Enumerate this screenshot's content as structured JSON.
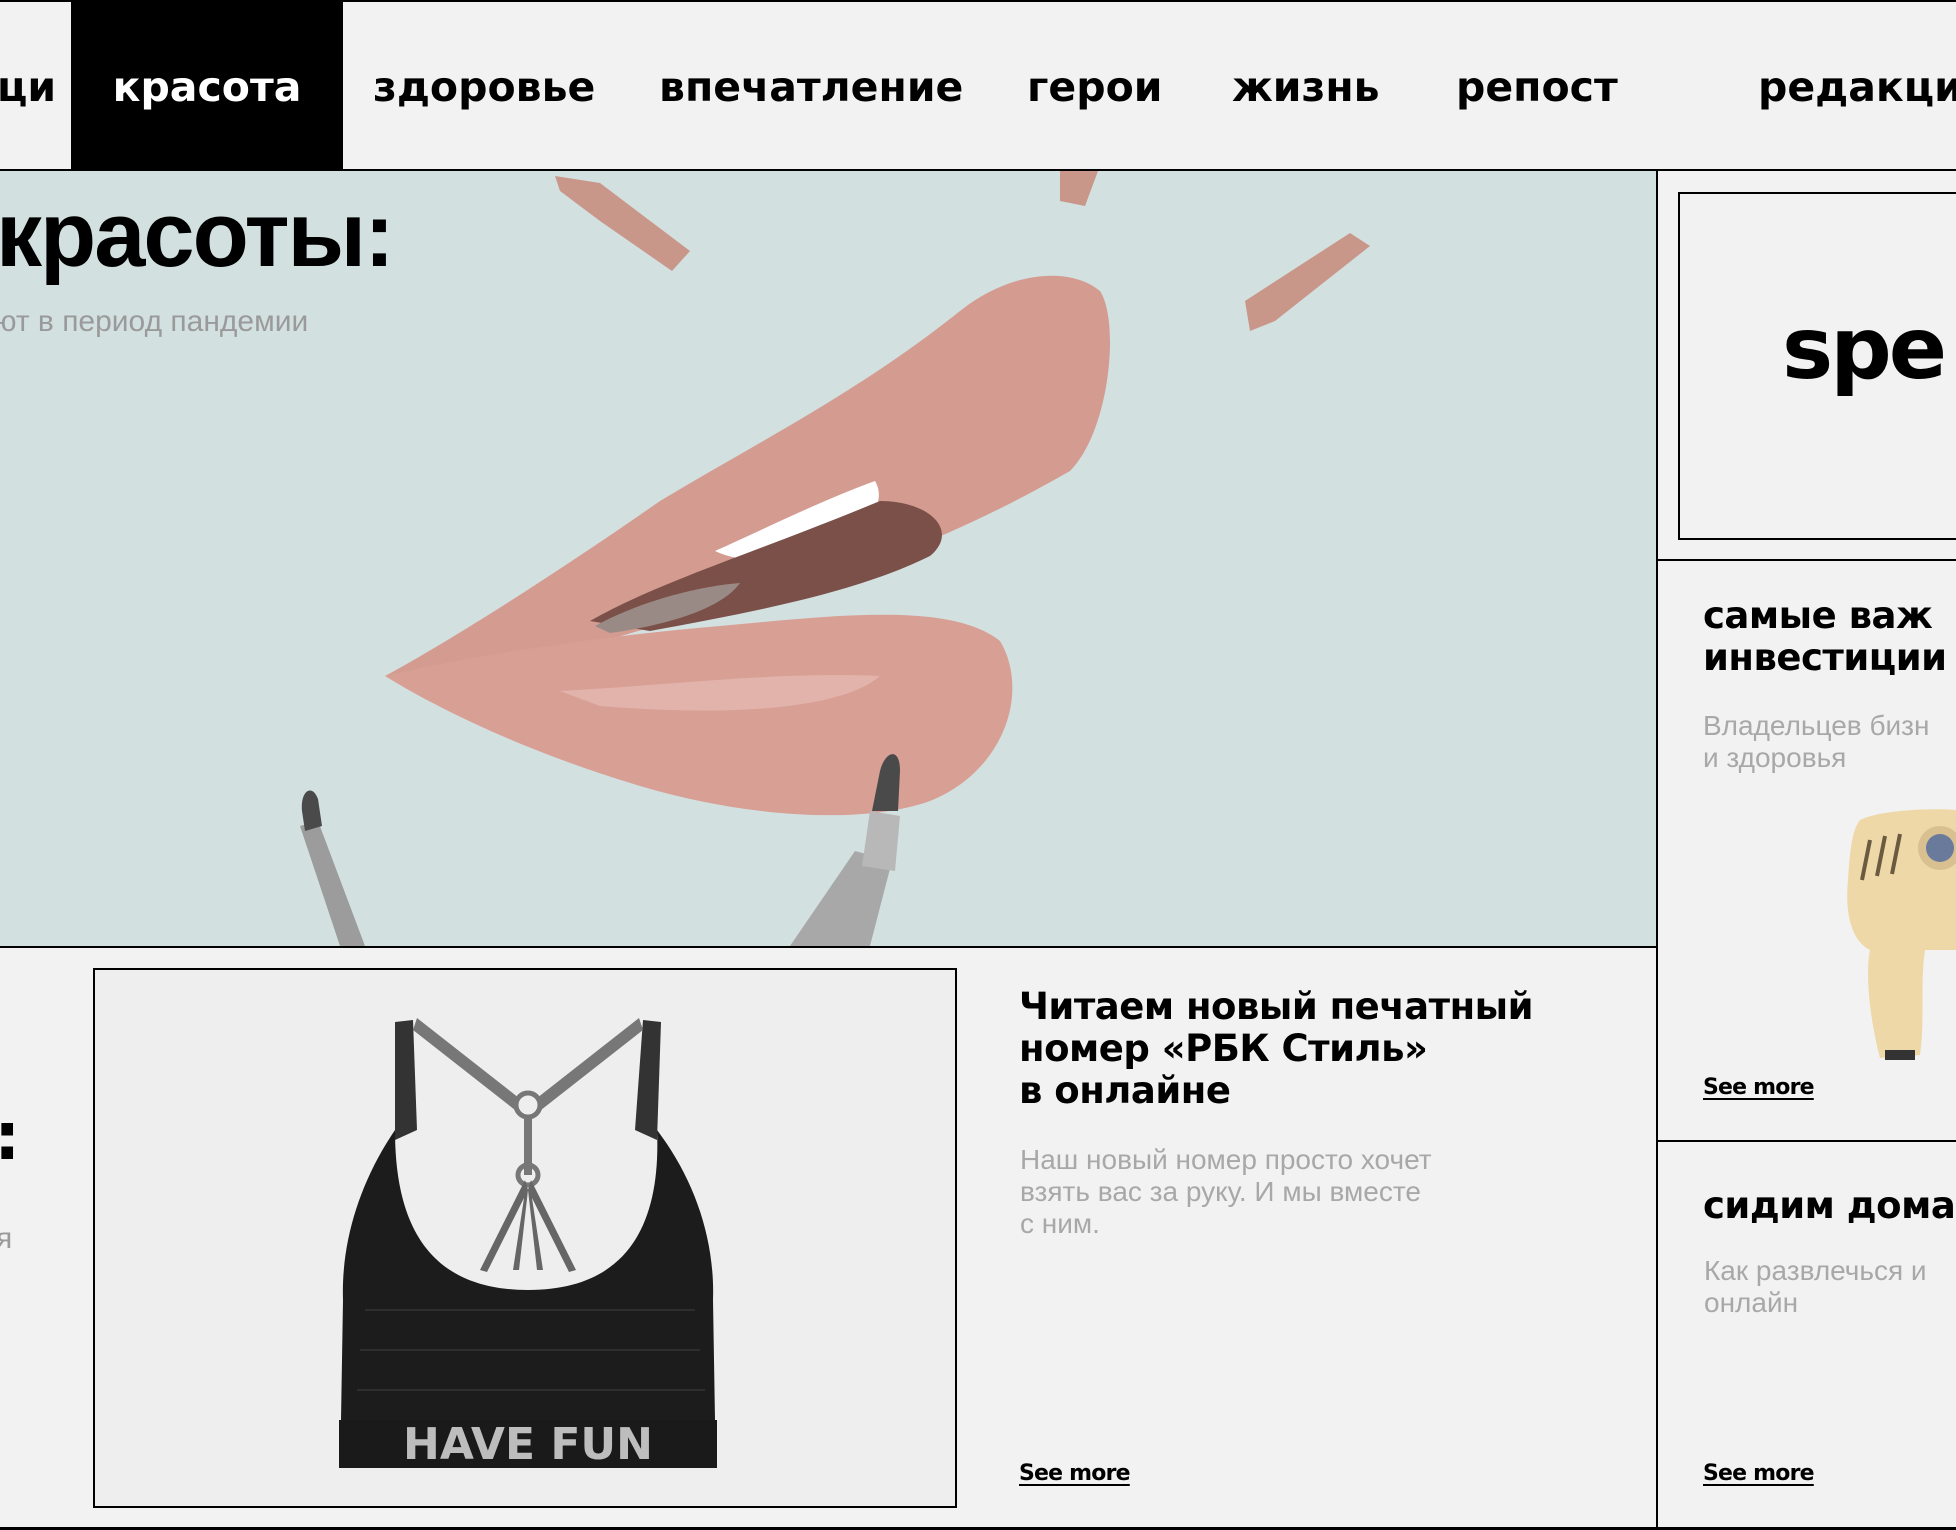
{
  "nav": {
    "items": [
      {
        "label": "ци"
      },
      {
        "label": "красота",
        "active": true
      },
      {
        "label": "здоровье"
      },
      {
        "label": "впечатление"
      },
      {
        "label": "герои"
      },
      {
        "label": "жизнь"
      },
      {
        "label": "репост"
      },
      {
        "label": "редакцис"
      }
    ]
  },
  "hero": {
    "title": "красоты:",
    "subtitle": "ют в период пандемии"
  },
  "left_fragment": {
    "colon": ":",
    "desc": "я"
  },
  "product": {
    "print": "HAVE FUN"
  },
  "article": {
    "title_lines": [
      "Читаем новый печатный",
      "номер «РБК Стиль»",
      "в онлайне"
    ],
    "desc_lines": [
      "Наш новый номер просто хочет",
      "взять вас за руку. И мы вместе",
      "с ним."
    ],
    "see_more": "See more"
  },
  "right": {
    "promo": "spe",
    "card1": {
      "title_lines": [
        "самые важ",
        "инвестиции"
      ],
      "desc_lines": [
        "Владельцев бизн",
        "и здоровья"
      ],
      "see_more": "See more"
    },
    "card2": {
      "title": "сидим дома",
      "desc_lines": [
        "Как развлечься и",
        "онлайн"
      ],
      "see_more": "See more"
    }
  },
  "colors": {
    "background": "#f2f2f2",
    "hero_bg": "#d3e0e0",
    "active_nav": "#000000",
    "muted_text": "#a8a8a8"
  }
}
